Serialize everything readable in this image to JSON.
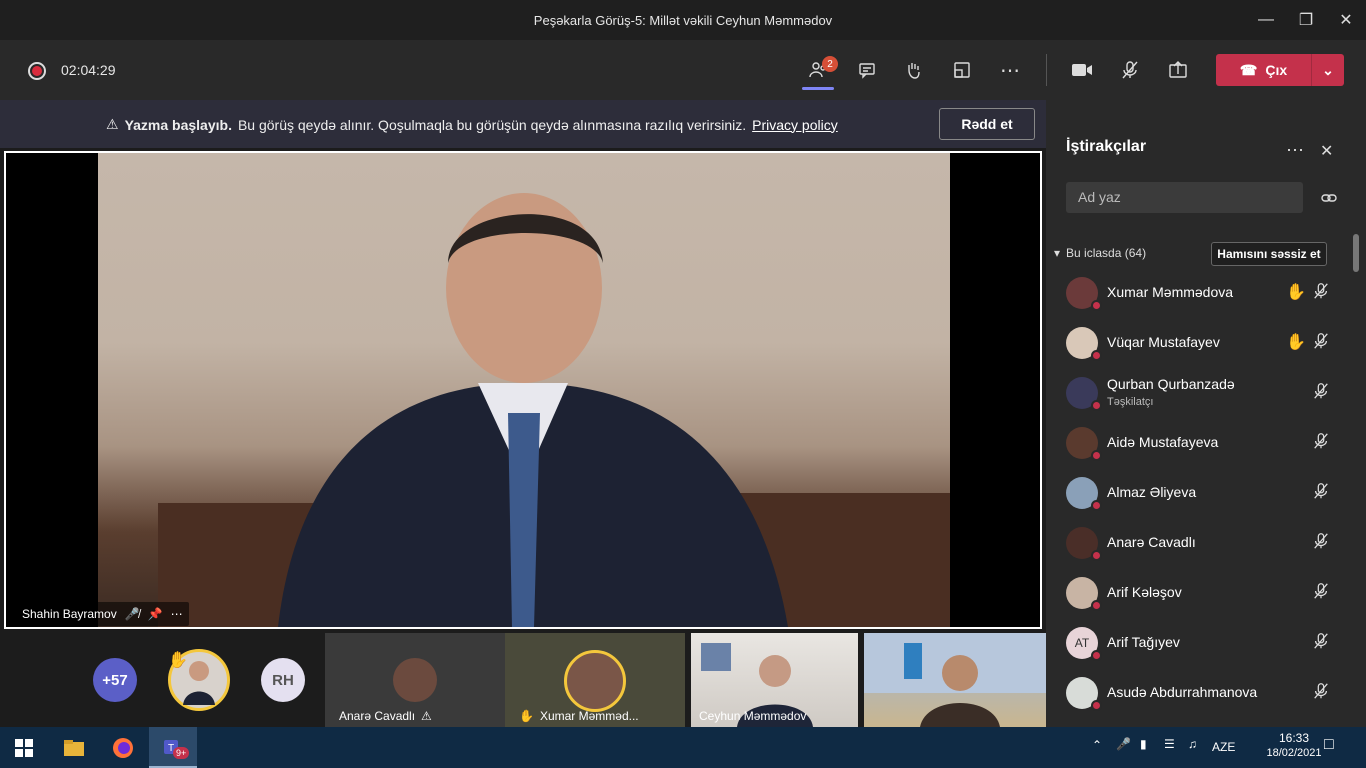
{
  "window": {
    "title": "Peşəkarla Görüş-5: Millət vəkili Ceyhun Məmmədov"
  },
  "toolbar": {
    "timer": "02:04:29",
    "participants_badge": "2",
    "leave_label": "Çıx"
  },
  "banner": {
    "bold": "Yazma başlayıb.",
    "text": "Bu görüş qeydə alınır. Qoşulmaqla bu görüşün qeydə alınmasına razılıq verirsiniz.",
    "link": "Privacy policy",
    "dismiss": "Rədd et"
  },
  "main_video": {
    "name": "Shahin Bayramov"
  },
  "strip": {
    "overflow": "+57",
    "rh": "RH",
    "tiles": [
      {
        "name": "Anarə Cavadlı"
      },
      {
        "name": "Xumar Məmməd..."
      },
      {
        "name": "Ceyhun Məmmədov"
      }
    ]
  },
  "panel": {
    "title": "İştirakçılar",
    "search_placeholder": "Ad yaz",
    "section": "Bu iclasda (64)",
    "mute_all": "Hamısını səssiz et",
    "participants": [
      {
        "name": "Xumar Məmmədova",
        "sub": "",
        "hand": true,
        "initials": ""
      },
      {
        "name": "Vüqar Mustafayev",
        "sub": "",
        "hand": true,
        "initials": ""
      },
      {
        "name": "Qurban Qurbanzadə",
        "sub": "Təşkilatçı",
        "hand": false,
        "initials": ""
      },
      {
        "name": "Aidə Mustafayeva",
        "sub": "",
        "hand": false,
        "initials": ""
      },
      {
        "name": "Almaz Əliyeva",
        "sub": "",
        "hand": false,
        "initials": ""
      },
      {
        "name": "Anarə Cavadlı",
        "sub": "",
        "hand": false,
        "initials": ""
      },
      {
        "name": "Arif Kələşov",
        "sub": "",
        "hand": false,
        "initials": ""
      },
      {
        "name": "Arif Tağıyev",
        "sub": "",
        "hand": false,
        "initials": "AT"
      },
      {
        "name": "Asudə Abdurrahmanova",
        "sub": "",
        "hand": false,
        "initials": ""
      }
    ]
  },
  "taskbar": {
    "teams_badge": "9+",
    "lang": "AZE",
    "time": "16:33",
    "date": "18/02/2021"
  }
}
